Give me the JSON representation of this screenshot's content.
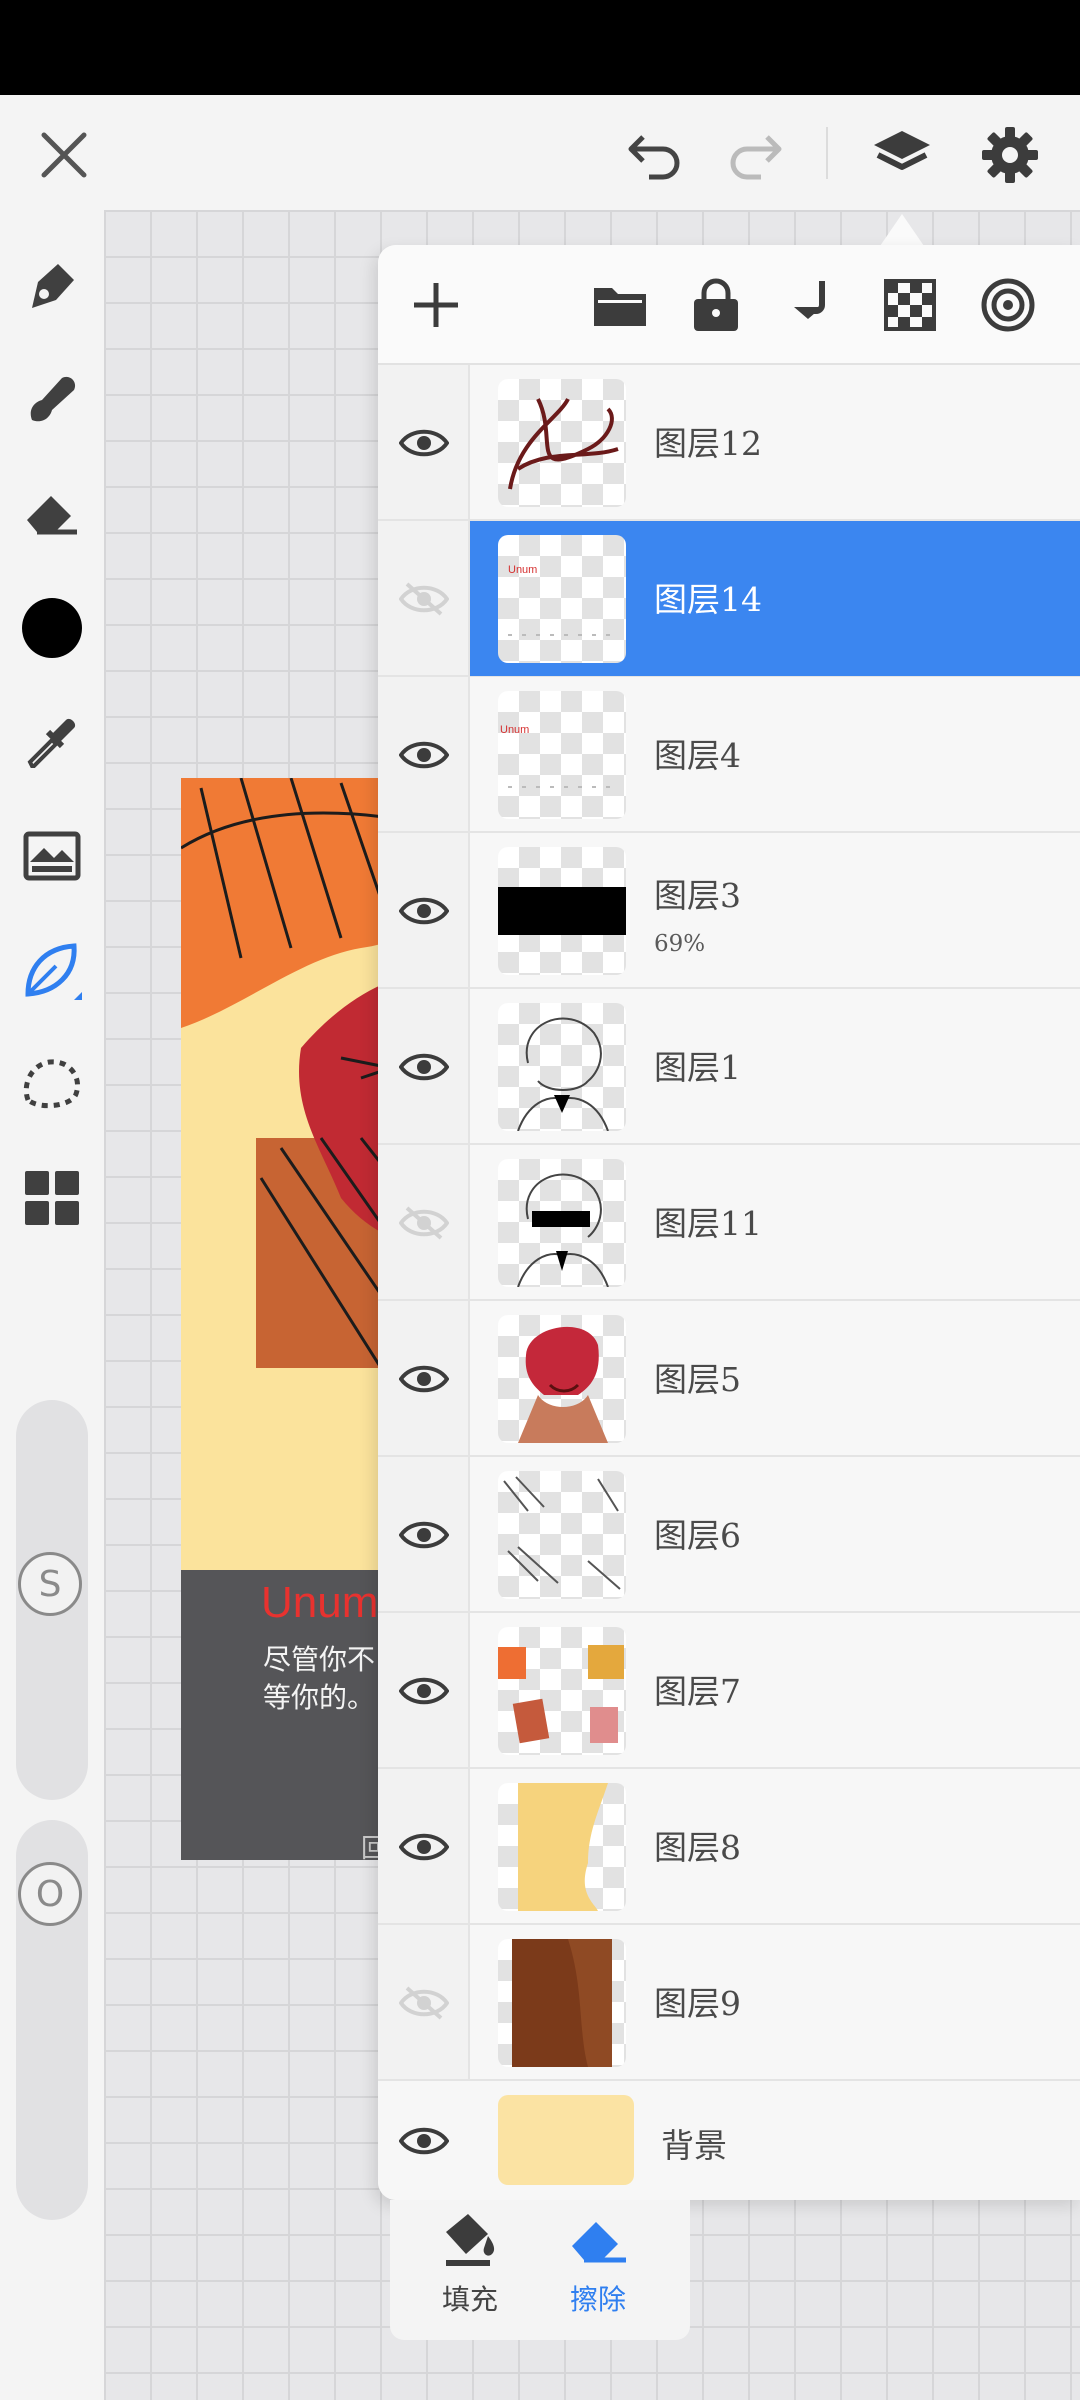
{
  "topbar": {
    "close_icon": "close-icon",
    "undo_icon": "undo-icon",
    "redo_icon": "redo-icon",
    "layers_icon": "layers-icon",
    "settings_icon": "gear-icon"
  },
  "left_tools": [
    {
      "name": "pen-icon"
    },
    {
      "name": "brush-icon"
    },
    {
      "name": "eraser-icon"
    },
    {
      "name": "color-swatch",
      "color": "#000000"
    },
    {
      "name": "eyedropper-icon"
    },
    {
      "name": "image-adjust-icon"
    },
    {
      "name": "leaf-shape-icon",
      "active": true
    },
    {
      "name": "lasso-icon"
    },
    {
      "name": "grid-menu-icon"
    }
  ],
  "sliders": {
    "size_label": "S",
    "opacity_label": "O"
  },
  "artwork": {
    "caption_name": "Unum",
    "caption_line1": "尽管你不",
    "caption_line2": "等你的。",
    "caption_mark": "回"
  },
  "layer_panel": {
    "toolbar_icons": [
      "add-icon",
      "folder-icon",
      "lock-icon",
      "merge-down-icon",
      "checker-icon",
      "target-icon"
    ],
    "layers": [
      {
        "name": "图层12",
        "visible": true,
        "selected": false
      },
      {
        "name": "图层14",
        "visible": false,
        "selected": true,
        "thumb_text": "Unum"
      },
      {
        "name": "图层4",
        "visible": true,
        "selected": false,
        "thumb_text": "Unum"
      },
      {
        "name": "图层3",
        "visible": true,
        "selected": false,
        "opacity": "69%"
      },
      {
        "name": "图层1",
        "visible": true,
        "selected": false
      },
      {
        "name": "图层11",
        "visible": false,
        "selected": false
      },
      {
        "name": "图层5",
        "visible": true,
        "selected": false
      },
      {
        "name": "图层6",
        "visible": true,
        "selected": false
      },
      {
        "name": "图层7",
        "visible": true,
        "selected": false
      },
      {
        "name": "图层8",
        "visible": true,
        "selected": false
      },
      {
        "name": "图层9",
        "visible": false,
        "selected": false
      }
    ],
    "background": {
      "name": "背景",
      "visible": true,
      "color": "#fbe3a3"
    }
  },
  "bottom_actions": {
    "fill_label": "填充",
    "erase_label": "擦除",
    "active": "擦除"
  },
  "colors": {
    "accent": "#3b86f0",
    "canvas_bg": "#fbe39c"
  }
}
